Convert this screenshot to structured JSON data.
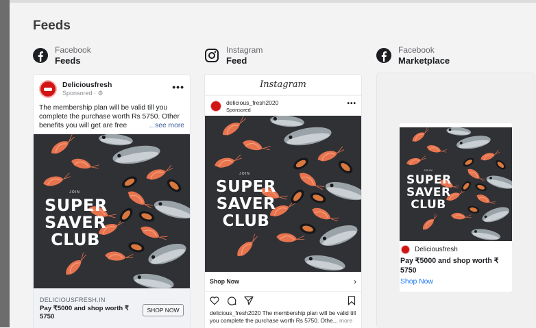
{
  "page": {
    "title": "Feeds"
  },
  "colors": {
    "facebook_blue": "#1877f2",
    "brand_red": "#d11414",
    "promo_bg": "#2f3034"
  },
  "promo": {
    "join": "JOIN",
    "line1": "SUPER",
    "line2": "SAVER",
    "line3": "CLUB"
  },
  "previews": {
    "facebook_feed": {
      "platform": "Facebook",
      "placement": "Feeds",
      "page_name": "Deliciousfresh",
      "sponsored": "Sponsored · ⚙",
      "primary_text": "The membership plan will be valid till you complete the purchase worth Rs 5750. Other benefits you will get are free",
      "see_more": "...see more",
      "domain": "DELICIOUSFRESH.IN",
      "headline": "Pay ₹5000 and shop worth ₹ 5750",
      "cta": "SHOP NOW"
    },
    "instagram_feed": {
      "platform": "Instagram",
      "placement": "Feed",
      "logo": "Instagram",
      "username": "delicious_fresh2020",
      "sponsored": "Sponsored",
      "cta": "Shop Now",
      "caption": "delicious_fresh2020 The membership plan will be valid till you complete the purchase worth Rs 5750. Othe...",
      "more": "more"
    },
    "facebook_marketplace": {
      "platform": "Facebook",
      "placement": "Marketplace",
      "page_name": "Deliciousfresh",
      "headline": "Pay ₹5000 and shop worth ₹ 5750",
      "cta": "Shop Now"
    }
  }
}
